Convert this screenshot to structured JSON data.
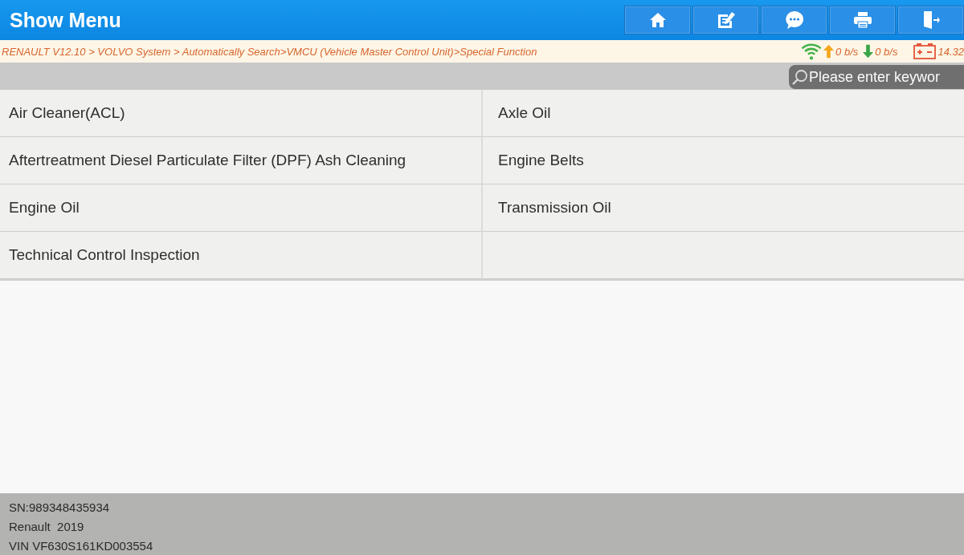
{
  "header": {
    "title": "Show Menu",
    "buttons": [
      {
        "kind": "home"
      },
      {
        "kind": "edit"
      },
      {
        "kind": "chat"
      },
      {
        "kind": "print"
      },
      {
        "kind": "exit"
      }
    ]
  },
  "breadcrumb": "RENAULT V12.10 > VOLVO System > Automatically Search>VMCU (Vehicle Master Control Unit)>Special Function",
  "status": {
    "upload": "0 b/s",
    "download": "0 b/s",
    "voltage": "14.32"
  },
  "search": {
    "placeholder": "Please enter keywor"
  },
  "menu": {
    "items": [
      {
        "label": "Air Cleaner(ACL)"
      },
      {
        "label": "Axle Oil"
      },
      {
        "label": "Aftertreatment Diesel Particulate Filter (DPF) Ash Cleaning"
      },
      {
        "label": "Engine Belts"
      },
      {
        "label": "Engine Oil"
      },
      {
        "label": "Transmission Oil"
      },
      {
        "label": "Technical Control Inspection"
      }
    ]
  },
  "footer": {
    "lines": [
      "SN:989348435934",
      "Renault  2019",
      "VIN VF630S161KD003554"
    ]
  }
}
